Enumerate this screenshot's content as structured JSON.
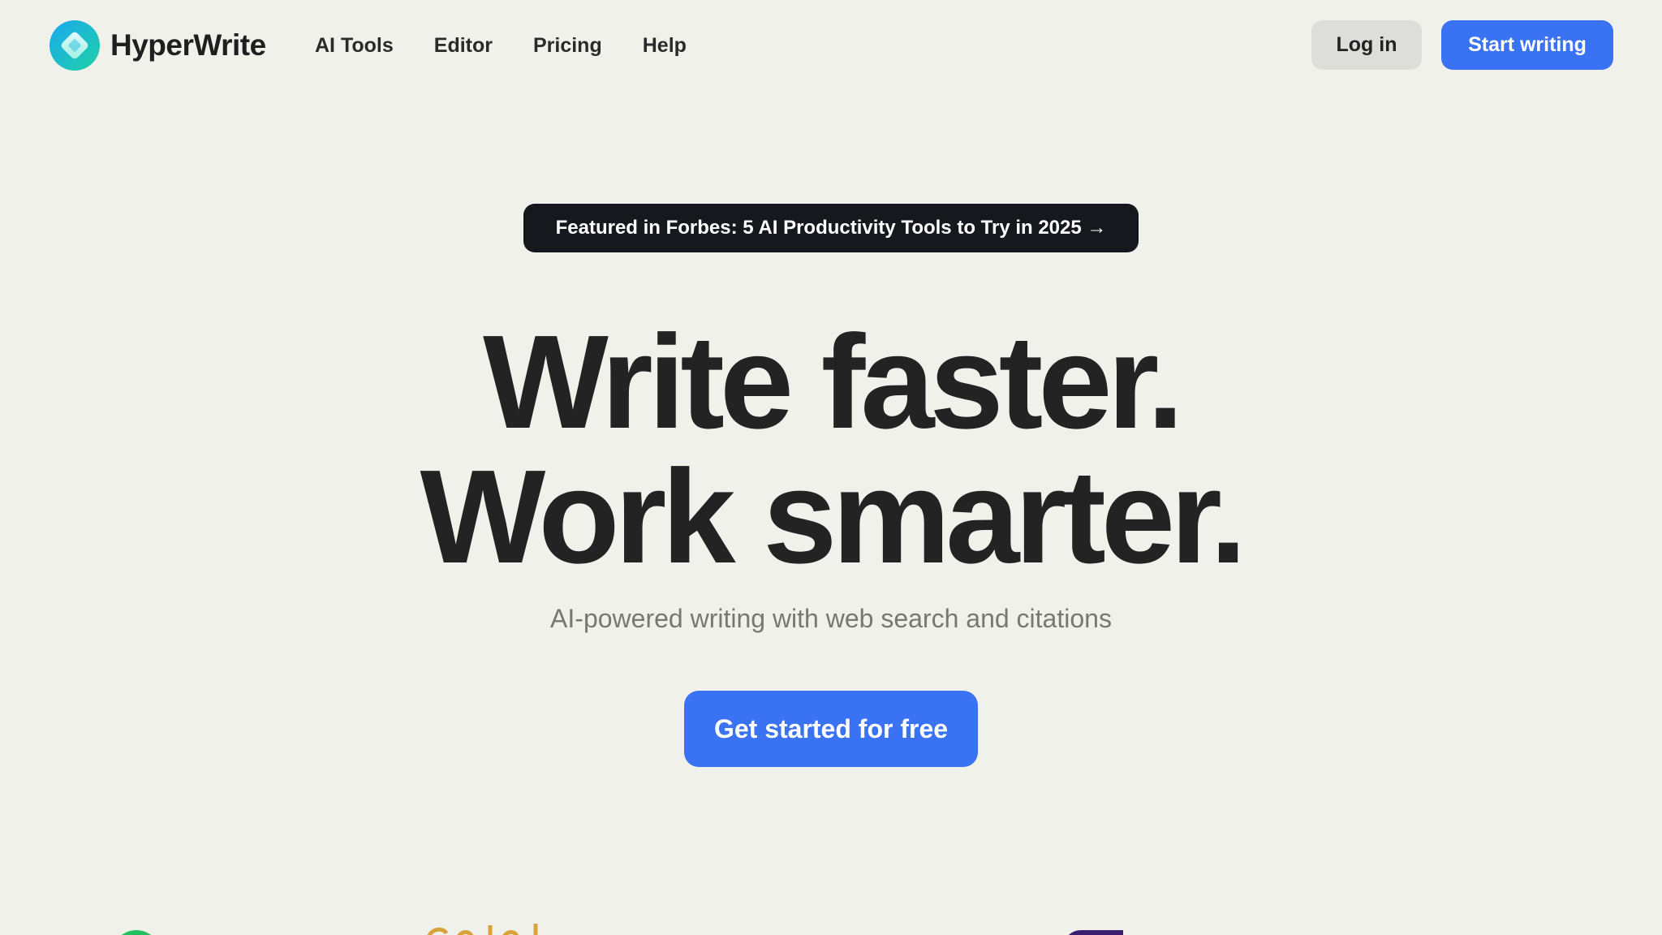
{
  "nav": {
    "brand": "HyperWrite",
    "links": [
      "AI Tools",
      "Editor",
      "Pricing",
      "Help"
    ],
    "login_label": "Log in",
    "start_label": "Start writing"
  },
  "hero": {
    "featured": "Featured in Forbes: 5 AI Productivity Tools to Try in 2025 →",
    "headline_line1": "Write faster.",
    "headline_line2": "Work smarter.",
    "subhead": "AI-powered writing with web search and citations",
    "cta_label": "Get started for free"
  },
  "colors": {
    "background": "#f1f1ec",
    "accent": "#3a72f4",
    "dark_badge": "#15181d",
    "login_bg": "#dddeda"
  },
  "icons": {
    "brand_logo": "hyperwrite-logo-icon"
  }
}
